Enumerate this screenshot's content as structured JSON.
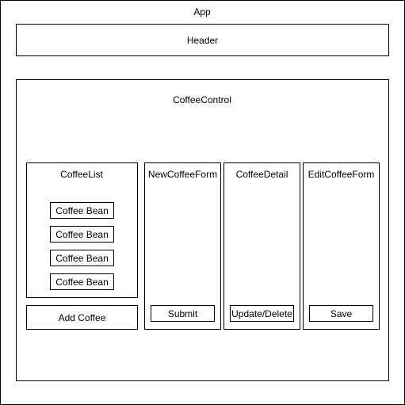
{
  "app": {
    "label": "App"
  },
  "header": {
    "label": "Header"
  },
  "coffee_control": {
    "label": "CoffeeControl"
  },
  "coffee_list": {
    "label": "CoffeeList",
    "items": [
      "Coffee Bean",
      "Coffee Bean",
      "Coffee Bean",
      "Coffee Bean"
    ],
    "add_button": "Add Coffee"
  },
  "new_coffee_form": {
    "label": "NewCoffeeForm",
    "button": "Submit"
  },
  "coffee_detail": {
    "label": "CoffeeDetail",
    "button": "Update/Delete"
  },
  "edit_coffee_form": {
    "label": "EditCoffeeForm",
    "button": "Save"
  }
}
